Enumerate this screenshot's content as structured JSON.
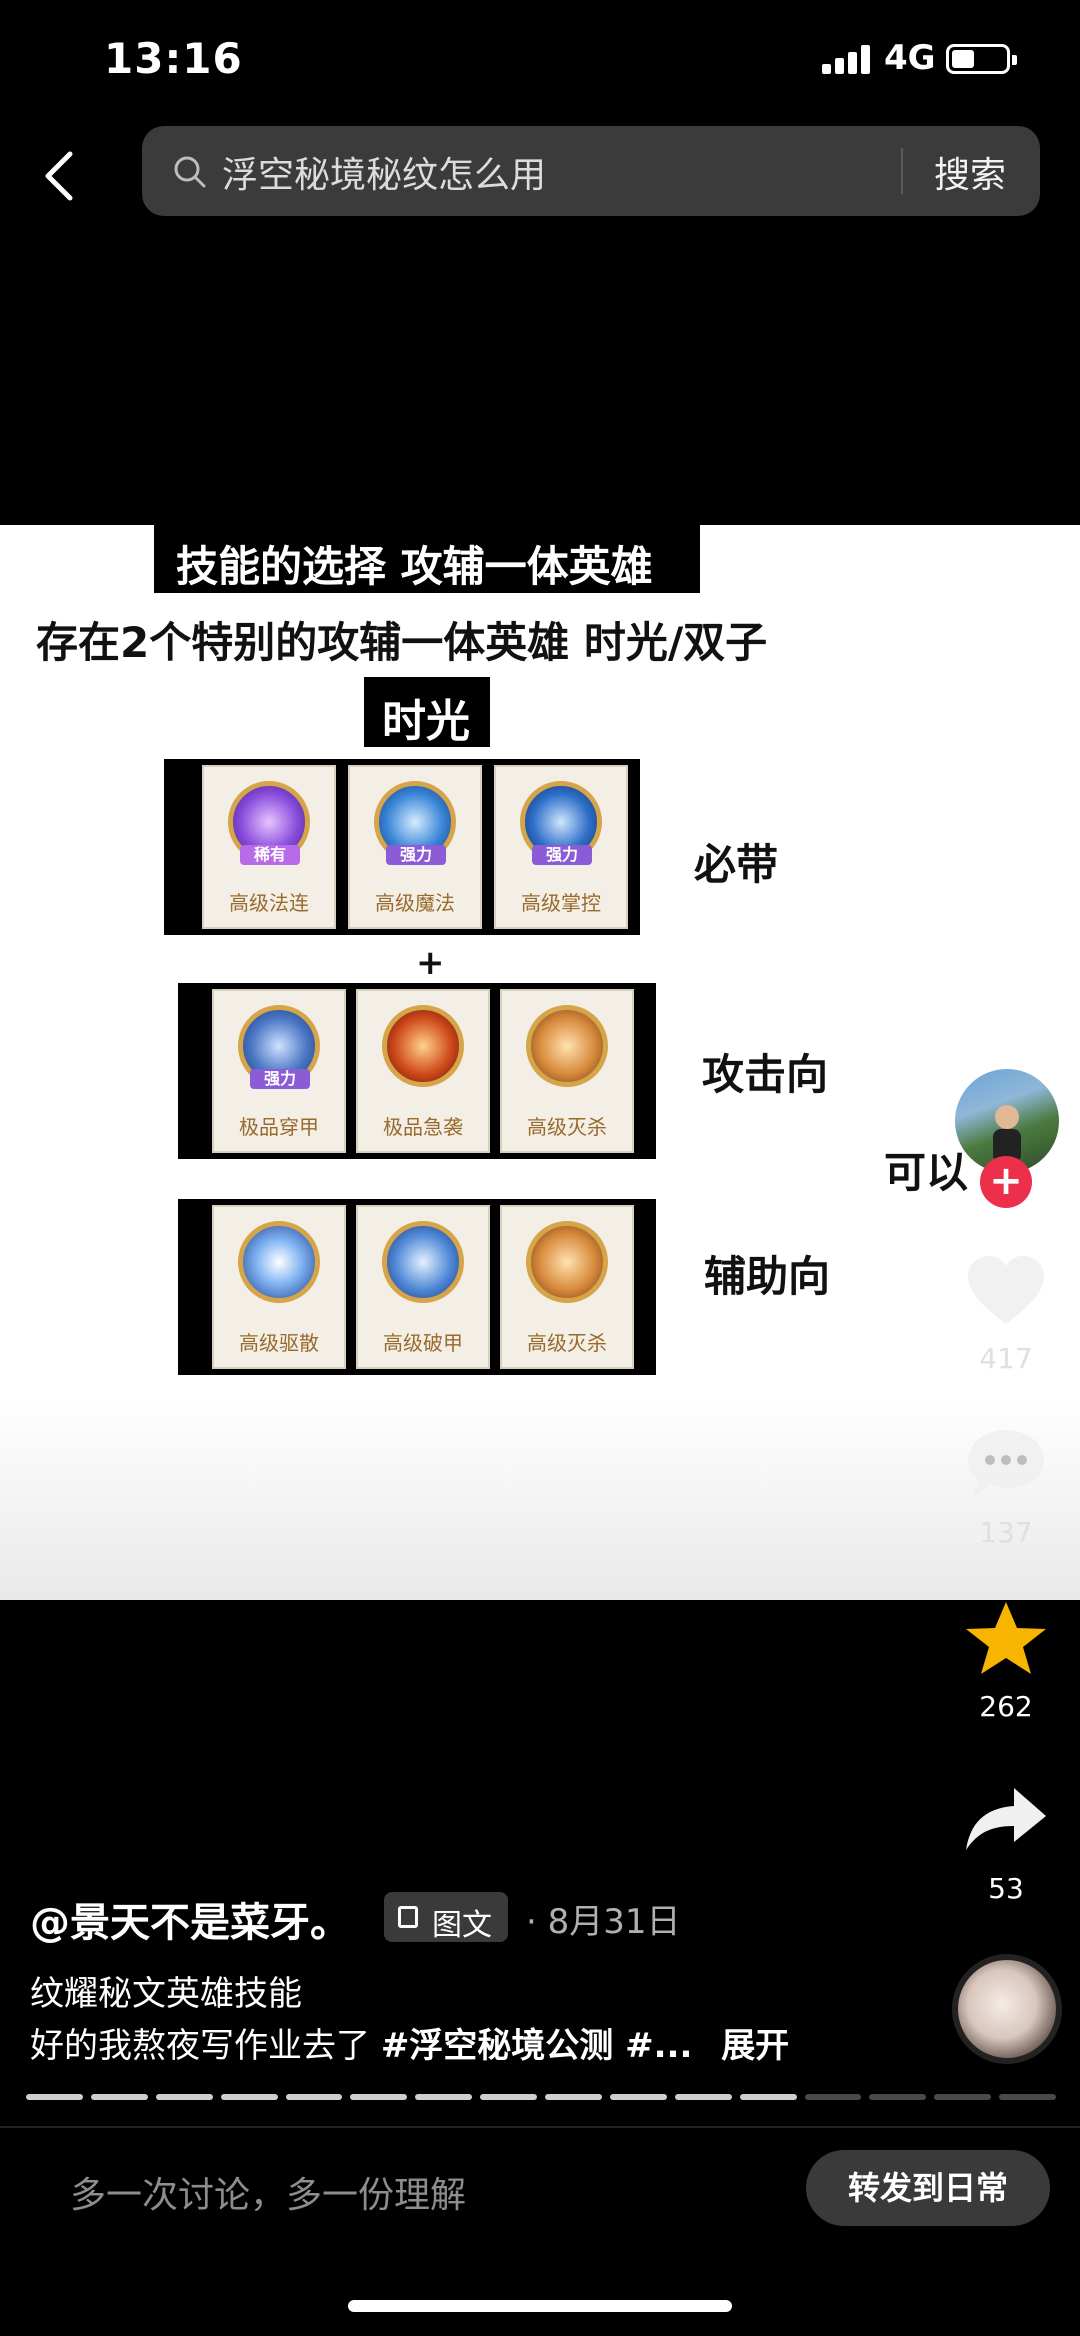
{
  "status_bar": {
    "time": "13:16",
    "network": "4G"
  },
  "search": {
    "query": "浮空秘境秘纹怎么用",
    "button": "搜索"
  },
  "post_image": {
    "header": "技能的选择 攻辅一体英雄",
    "subtitle": "存在2个特别的攻辅一体英雄 时光/双子",
    "hero": "时光",
    "plus": "+",
    "side_note": "可以",
    "rows": [
      {
        "label": "必带",
        "cards": [
          {
            "name": "高级法连",
            "tag": "稀有",
            "color": "#7a3fd6",
            "tagColor": "#b86be6"
          },
          {
            "name": "高级魔法",
            "tag": "强力",
            "color": "#2d6fc4",
            "tagColor": "#8b5cd6"
          },
          {
            "name": "高级掌控",
            "tag": "强力",
            "color": "#2f62b8",
            "tagColor": "#8b5cd6"
          }
        ]
      },
      {
        "label": "攻击向",
        "cards": [
          {
            "name": "极品穿甲",
            "tag": "强力",
            "color": "#3b66b8",
            "tagColor": "#8b5cd6"
          },
          {
            "name": "极品急袭",
            "tag": "",
            "color": "#c8481e",
            "tagColor": ""
          },
          {
            "name": "高级灭杀",
            "tag": "",
            "color": "#d0843a",
            "tagColor": ""
          }
        ]
      },
      {
        "label": "辅助向",
        "cards": [
          {
            "name": "高级驱散",
            "tag": "",
            "color": "#3a78d6",
            "tagColor": ""
          },
          {
            "name": "高级破甲",
            "tag": "",
            "color": "#3f7ad0",
            "tagColor": ""
          },
          {
            "name": "高级灭杀",
            "tag": "",
            "color": "#d0843a",
            "tagColor": ""
          }
        ]
      }
    ]
  },
  "side_actions": {
    "likes": "417",
    "comments": "137",
    "favorites": "262",
    "shares": "53"
  },
  "caption": {
    "author": "@景天不是菜牙。",
    "type_badge": "图文",
    "date": "· 8月31日",
    "line1": "纹耀秘文英雄技能",
    "line2": "好的我熬夜写作业去了",
    "tags": "#浮空秘境公测 #...",
    "expand": "展开"
  },
  "progress": {
    "total_segments": 16,
    "active_segments": 12
  },
  "bottom_bar": {
    "comment_placeholder": "多一次讨论，多一份理解",
    "share_button": "转发到日常"
  },
  "colors": {
    "accent_star": "#f7b500",
    "follow_red": "#ec2f4b"
  }
}
